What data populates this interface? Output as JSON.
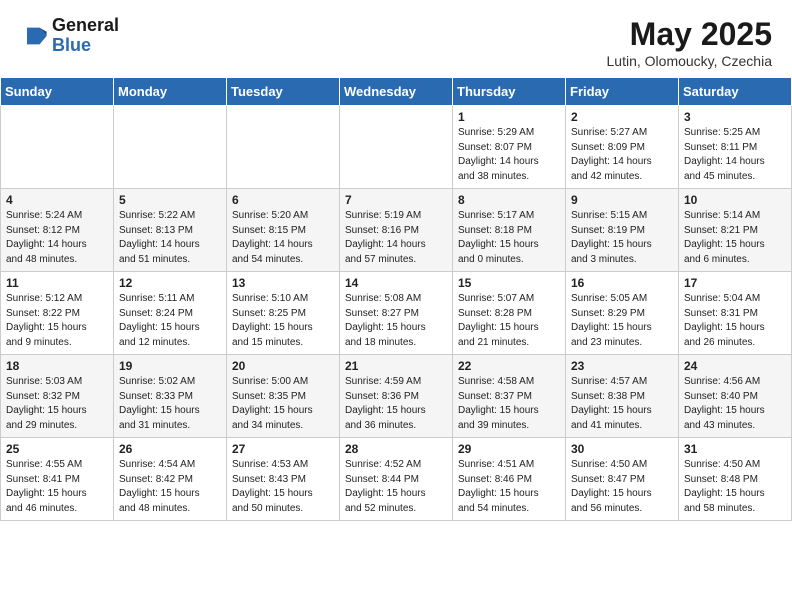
{
  "header": {
    "logo_general": "General",
    "logo_blue": "Blue",
    "month_year": "May 2025",
    "location": "Lutin, Olomoucky, Czechia"
  },
  "weekdays": [
    "Sunday",
    "Monday",
    "Tuesday",
    "Wednesday",
    "Thursday",
    "Friday",
    "Saturday"
  ],
  "weeks": [
    [
      {
        "day": "",
        "info": ""
      },
      {
        "day": "",
        "info": ""
      },
      {
        "day": "",
        "info": ""
      },
      {
        "day": "",
        "info": ""
      },
      {
        "day": "1",
        "info": "Sunrise: 5:29 AM\nSunset: 8:07 PM\nDaylight: 14 hours\nand 38 minutes."
      },
      {
        "day": "2",
        "info": "Sunrise: 5:27 AM\nSunset: 8:09 PM\nDaylight: 14 hours\nand 42 minutes."
      },
      {
        "day": "3",
        "info": "Sunrise: 5:25 AM\nSunset: 8:11 PM\nDaylight: 14 hours\nand 45 minutes."
      }
    ],
    [
      {
        "day": "4",
        "info": "Sunrise: 5:24 AM\nSunset: 8:12 PM\nDaylight: 14 hours\nand 48 minutes."
      },
      {
        "day": "5",
        "info": "Sunrise: 5:22 AM\nSunset: 8:13 PM\nDaylight: 14 hours\nand 51 minutes."
      },
      {
        "day": "6",
        "info": "Sunrise: 5:20 AM\nSunset: 8:15 PM\nDaylight: 14 hours\nand 54 minutes."
      },
      {
        "day": "7",
        "info": "Sunrise: 5:19 AM\nSunset: 8:16 PM\nDaylight: 14 hours\nand 57 minutes."
      },
      {
        "day": "8",
        "info": "Sunrise: 5:17 AM\nSunset: 8:18 PM\nDaylight: 15 hours\nand 0 minutes."
      },
      {
        "day": "9",
        "info": "Sunrise: 5:15 AM\nSunset: 8:19 PM\nDaylight: 15 hours\nand 3 minutes."
      },
      {
        "day": "10",
        "info": "Sunrise: 5:14 AM\nSunset: 8:21 PM\nDaylight: 15 hours\nand 6 minutes."
      }
    ],
    [
      {
        "day": "11",
        "info": "Sunrise: 5:12 AM\nSunset: 8:22 PM\nDaylight: 15 hours\nand 9 minutes."
      },
      {
        "day": "12",
        "info": "Sunrise: 5:11 AM\nSunset: 8:24 PM\nDaylight: 15 hours\nand 12 minutes."
      },
      {
        "day": "13",
        "info": "Sunrise: 5:10 AM\nSunset: 8:25 PM\nDaylight: 15 hours\nand 15 minutes."
      },
      {
        "day": "14",
        "info": "Sunrise: 5:08 AM\nSunset: 8:27 PM\nDaylight: 15 hours\nand 18 minutes."
      },
      {
        "day": "15",
        "info": "Sunrise: 5:07 AM\nSunset: 8:28 PM\nDaylight: 15 hours\nand 21 minutes."
      },
      {
        "day": "16",
        "info": "Sunrise: 5:05 AM\nSunset: 8:29 PM\nDaylight: 15 hours\nand 23 minutes."
      },
      {
        "day": "17",
        "info": "Sunrise: 5:04 AM\nSunset: 8:31 PM\nDaylight: 15 hours\nand 26 minutes."
      }
    ],
    [
      {
        "day": "18",
        "info": "Sunrise: 5:03 AM\nSunset: 8:32 PM\nDaylight: 15 hours\nand 29 minutes."
      },
      {
        "day": "19",
        "info": "Sunrise: 5:02 AM\nSunset: 8:33 PM\nDaylight: 15 hours\nand 31 minutes."
      },
      {
        "day": "20",
        "info": "Sunrise: 5:00 AM\nSunset: 8:35 PM\nDaylight: 15 hours\nand 34 minutes."
      },
      {
        "day": "21",
        "info": "Sunrise: 4:59 AM\nSunset: 8:36 PM\nDaylight: 15 hours\nand 36 minutes."
      },
      {
        "day": "22",
        "info": "Sunrise: 4:58 AM\nSunset: 8:37 PM\nDaylight: 15 hours\nand 39 minutes."
      },
      {
        "day": "23",
        "info": "Sunrise: 4:57 AM\nSunset: 8:38 PM\nDaylight: 15 hours\nand 41 minutes."
      },
      {
        "day": "24",
        "info": "Sunrise: 4:56 AM\nSunset: 8:40 PM\nDaylight: 15 hours\nand 43 minutes."
      }
    ],
    [
      {
        "day": "25",
        "info": "Sunrise: 4:55 AM\nSunset: 8:41 PM\nDaylight: 15 hours\nand 46 minutes."
      },
      {
        "day": "26",
        "info": "Sunrise: 4:54 AM\nSunset: 8:42 PM\nDaylight: 15 hours\nand 48 minutes."
      },
      {
        "day": "27",
        "info": "Sunrise: 4:53 AM\nSunset: 8:43 PM\nDaylight: 15 hours\nand 50 minutes."
      },
      {
        "day": "28",
        "info": "Sunrise: 4:52 AM\nSunset: 8:44 PM\nDaylight: 15 hours\nand 52 minutes."
      },
      {
        "day": "29",
        "info": "Sunrise: 4:51 AM\nSunset: 8:46 PM\nDaylight: 15 hours\nand 54 minutes."
      },
      {
        "day": "30",
        "info": "Sunrise: 4:50 AM\nSunset: 8:47 PM\nDaylight: 15 hours\nand 56 minutes."
      },
      {
        "day": "31",
        "info": "Sunrise: 4:50 AM\nSunset: 8:48 PM\nDaylight: 15 hours\nand 58 minutes."
      }
    ]
  ]
}
